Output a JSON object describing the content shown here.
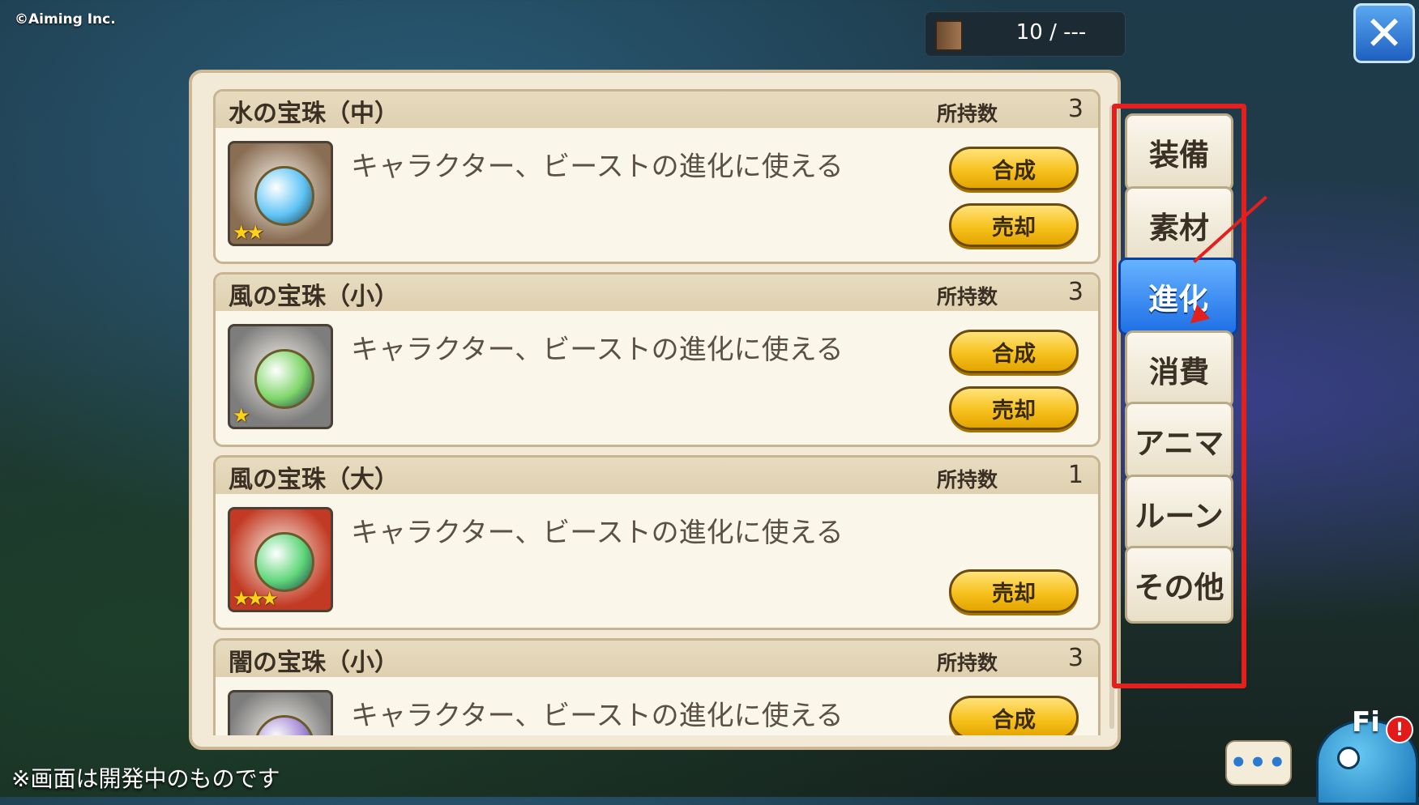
{
  "copyright": "©Aiming Inc.",
  "dev_note": "※画面は開発中のものです",
  "capacity": {
    "text": "10 / ---",
    "icon": "book-icon"
  },
  "close": {
    "icon": "close-icon",
    "glyph": "✕"
  },
  "owned_label": "所持数",
  "items": [
    {
      "name": "水の宝珠（中）",
      "count": "3",
      "desc": "キャラクター、ビーストの進化に使える",
      "stars": "★★",
      "buttons": [
        "合成",
        "売却"
      ],
      "orb_color": "#5fc4f5",
      "bg_color": "#8a6e54"
    },
    {
      "name": "風の宝珠（小）",
      "count": "3",
      "desc": "キャラクター、ビーストの進化に使える",
      "stars": "★",
      "buttons": [
        "合成",
        "売却"
      ],
      "orb_color": "#7fd66a",
      "bg_color": "#7d7d7d"
    },
    {
      "name": "風の宝珠（大）",
      "count": "1",
      "desc": "キャラクター、ビーストの進化に使える",
      "stars": "★★★",
      "buttons": [
        "売却"
      ],
      "orb_color": "#5fd67a",
      "bg_color": "#c23a24"
    },
    {
      "name": "闇の宝珠（小）",
      "count": "3",
      "desc": "キャラクター、ビーストの進化に使える",
      "stars": "",
      "buttons": [
        "合成"
      ],
      "orb_color": "#a58ad6",
      "bg_color": "#7d7d7d"
    }
  ],
  "tabs": [
    {
      "label": "装備",
      "active": false
    },
    {
      "label": "素材",
      "active": false
    },
    {
      "label": "進化",
      "active": true
    },
    {
      "label": "消費",
      "active": false
    },
    {
      "label": "アニマ",
      "active": false
    },
    {
      "label": "ルーン",
      "active": false
    },
    {
      "label": "その他",
      "active": false
    }
  ],
  "chat": {
    "glyph": "•••",
    "icon": "chat-bubble-icon"
  },
  "mascot": {
    "label": "Fi",
    "alert": "!"
  },
  "colors": {
    "highlight": "#e2201e",
    "active_tab": "#1f6fe6",
    "button": "#f7c21e"
  }
}
